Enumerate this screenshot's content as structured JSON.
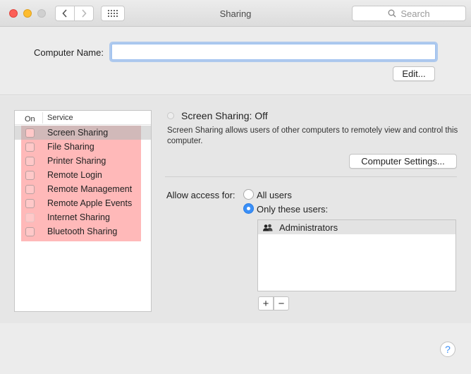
{
  "window": {
    "title": "Sharing"
  },
  "toolbar": {
    "search_placeholder": "Search"
  },
  "computer_name": {
    "label": "Computer Name:",
    "value": "",
    "edit_label": "Edit..."
  },
  "services": {
    "header_on": "On",
    "header_service": "Service",
    "items": [
      {
        "label": "Screen Sharing",
        "checked": false,
        "selected": true
      },
      {
        "label": "File Sharing",
        "checked": false
      },
      {
        "label": "Printer Sharing",
        "checked": false
      },
      {
        "label": "Remote Login",
        "checked": false
      },
      {
        "label": "Remote Management",
        "checked": false
      },
      {
        "label": "Remote Apple Events",
        "checked": false
      },
      {
        "label": "Internet Sharing",
        "checked": false,
        "disabled": true
      },
      {
        "label": "Bluetooth Sharing",
        "checked": false
      }
    ]
  },
  "detail": {
    "status_title": "Screen Sharing: Off",
    "description": "Screen Sharing allows users of other computers to remotely view and control this computer.",
    "computer_settings_label": "Computer Settings...",
    "access_label": "Allow access for:",
    "option_all": "All users",
    "option_only": "Only these users:",
    "selected_option": "Only these users:",
    "users": [
      "Administrators"
    ],
    "add_label": "+",
    "remove_label": "−"
  },
  "help": {
    "label": "?"
  },
  "colors": {
    "accent": "#3a8ff7",
    "highlight": "#ffb9b9",
    "close": "#fc5f57",
    "minimize": "#fdbc2e"
  }
}
